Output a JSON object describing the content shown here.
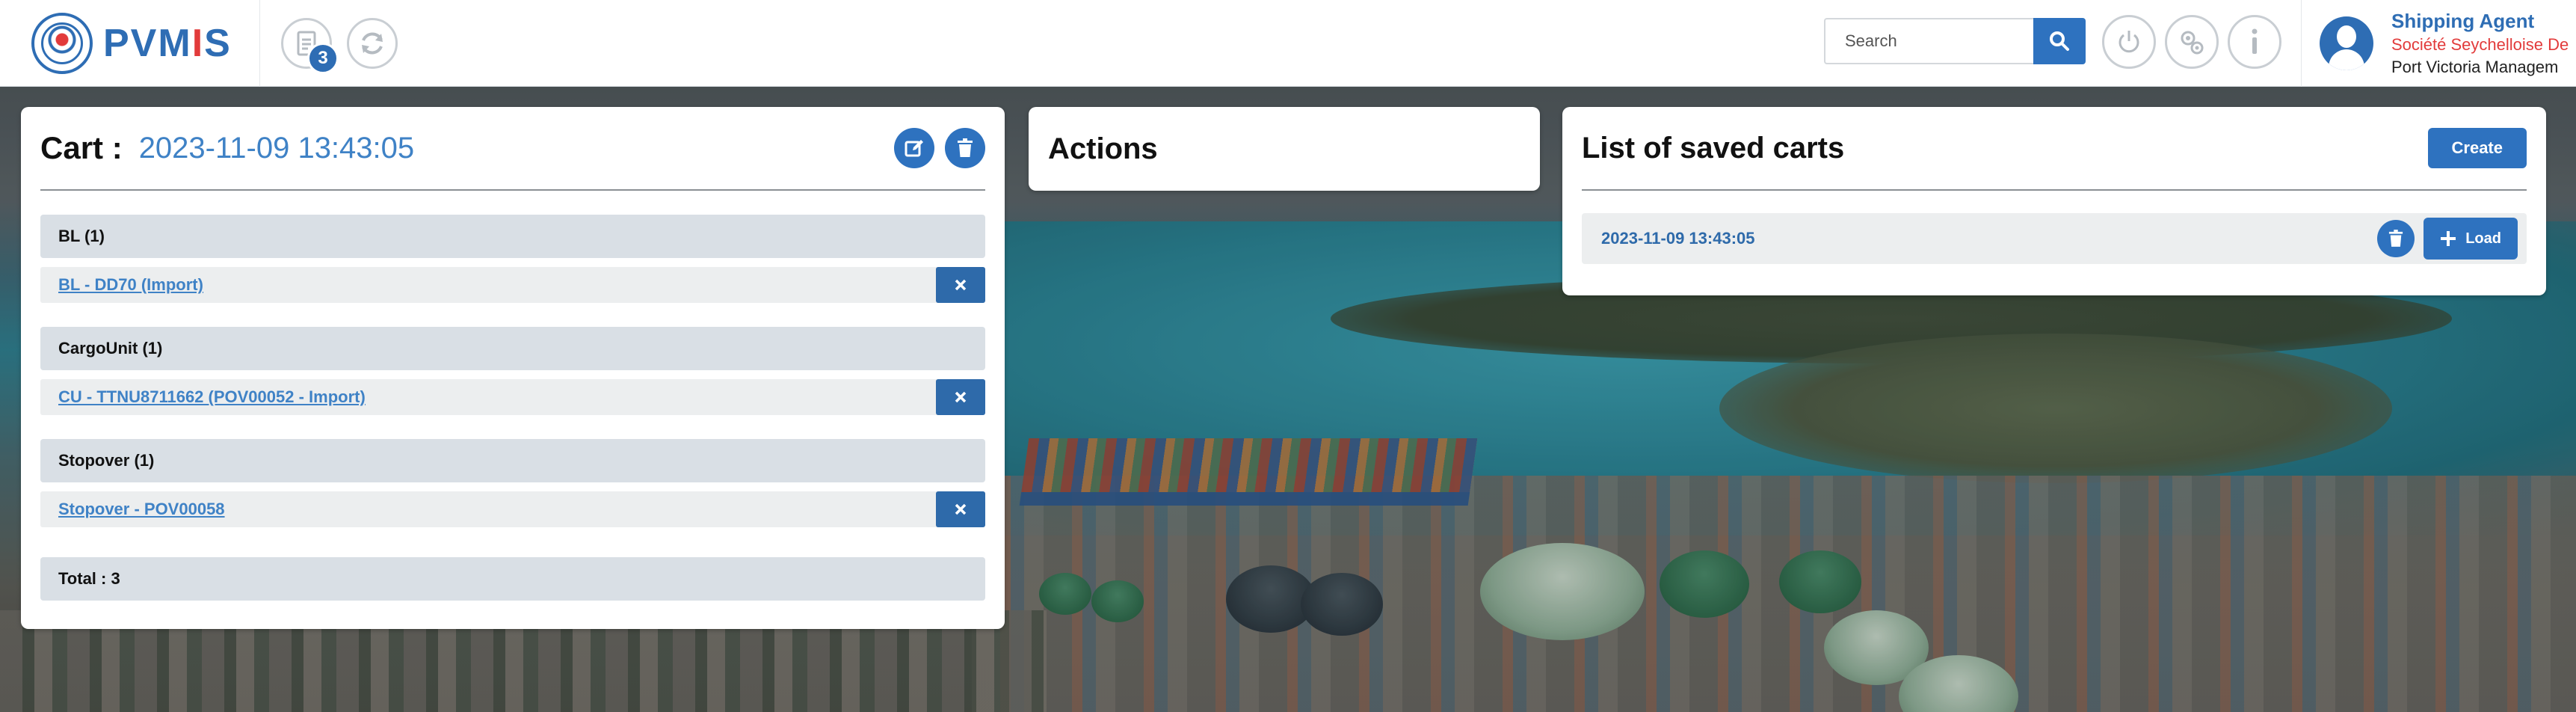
{
  "brand": {
    "name_prefix": "PVM",
    "name_accent": "I",
    "name_suffix": "S"
  },
  "toolbar": {
    "cart_count": "3"
  },
  "search": {
    "placeholder": "Search"
  },
  "user": {
    "role": "Shipping Agent",
    "company": "Société Seychelloise De",
    "port": "Port Victoria Managem"
  },
  "cart": {
    "title": "Cart :",
    "date": "2023-11-09 13:43:05",
    "groups": [
      {
        "header": "BL (1)",
        "item": "BL - DD70 (Import)"
      },
      {
        "header": "CargoUnit (1)",
        "item": "CU - TTNU8711662 (POV00052 - Import)"
      },
      {
        "header": "Stopover (1)",
        "item": "Stopover - POV00058"
      }
    ],
    "total": "Total : 3"
  },
  "actions": {
    "title": "Actions"
  },
  "saved_carts": {
    "title": "List of saved carts",
    "create_label": "Create",
    "rows": [
      {
        "date": "2023-11-09 13:43:05",
        "load_label": "Load"
      }
    ]
  },
  "colors": {
    "primary": "#2e72bf",
    "accent_red": "#e23b3b",
    "link": "#3f82c6"
  }
}
